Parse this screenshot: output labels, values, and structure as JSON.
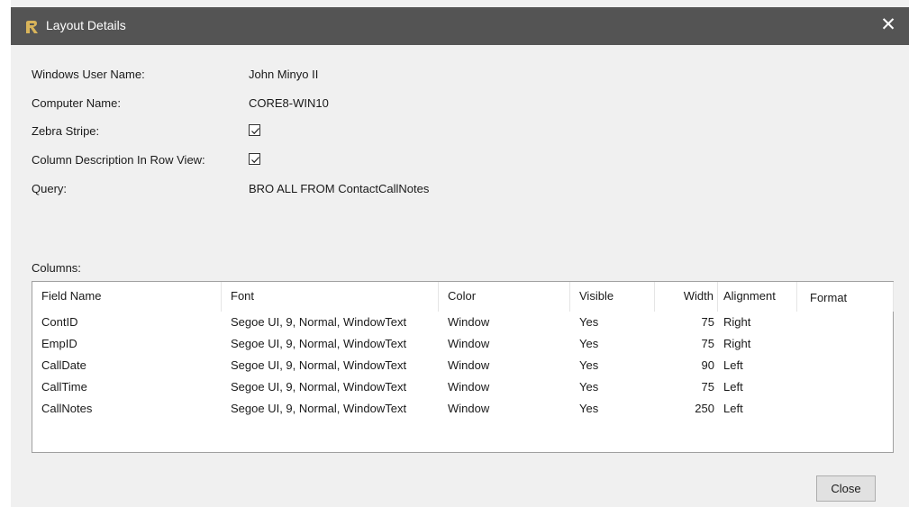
{
  "window": {
    "title": "Layout Details",
    "close_glyph": "✕",
    "icon": "app-logo-icon"
  },
  "details": {
    "user_label": "Windows User Name:",
    "user_value": "John Minyo II",
    "computer_label": "Computer Name:",
    "computer_value": "CORE8-WIN10",
    "zebra_label": "Zebra Stripe:",
    "zebra_checked": true,
    "coldesc_label": "Column Description In Row View:",
    "coldesc_checked": true,
    "query_label": "Query:",
    "query_value": "BRO ALL FROM ContactCallNotes"
  },
  "columns": {
    "label": "Columns:",
    "headers": [
      "Field Name",
      "Font",
      "Color",
      "Visible",
      "Width",
      "Alignment",
      "Format"
    ],
    "rows": [
      [
        "ContID",
        "Segoe UI, 9, Normal, WindowText",
        "Window",
        "Yes",
        "75",
        "Right",
        ""
      ],
      [
        "EmpID",
        "Segoe UI, 9, Normal, WindowText",
        "Window",
        "Yes",
        "75",
        "Right",
        ""
      ],
      [
        "CallDate",
        "Segoe UI, 9, Normal, WindowText",
        "Window",
        "Yes",
        "90",
        "Left",
        ""
      ],
      [
        "CallTime",
        "Segoe UI, 9, Normal, WindowText",
        "Window",
        "Yes",
        "75",
        "Left",
        ""
      ],
      [
        "CallNotes",
        "Segoe UI, 9, Normal, WindowText",
        "Window",
        "Yes",
        "250",
        "Left",
        ""
      ]
    ]
  },
  "buttons": {
    "close": "Close"
  },
  "colors": {
    "titlebar": "#545454",
    "dialog_bg": "#f0f0f0",
    "icon_accent": "#c8a24a"
  }
}
